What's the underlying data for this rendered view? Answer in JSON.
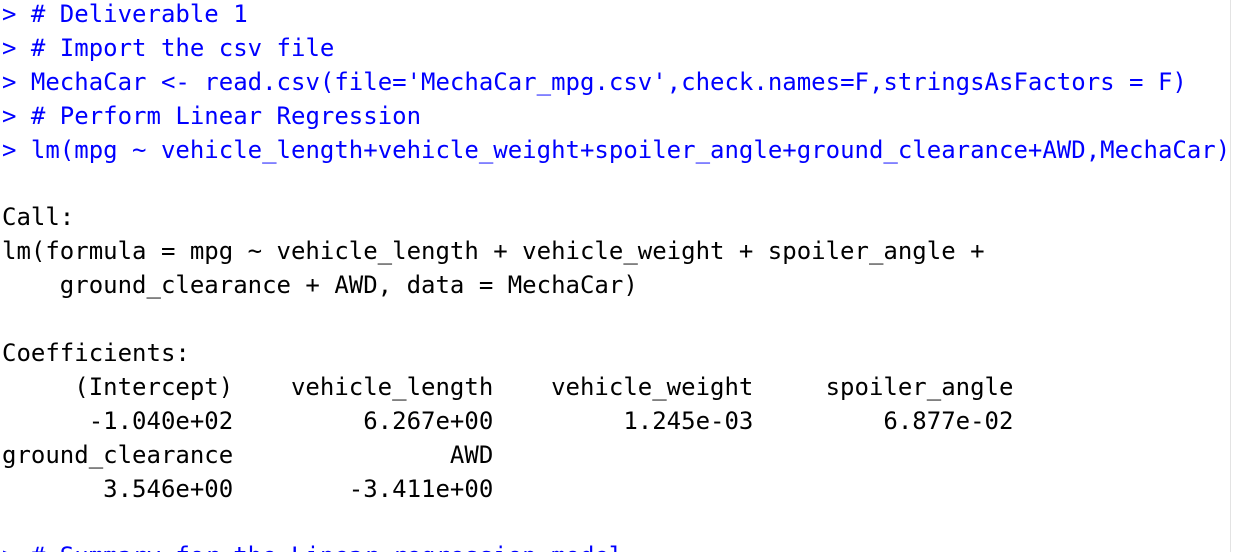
{
  "colors": {
    "input": "#0000ff",
    "output": "#000000",
    "background": "#ffffff"
  },
  "console": {
    "prompt": "> ",
    "commands": [
      "# Deliverable 1",
      "# Import the csv file",
      "MechaCar <- read.csv(file='MechaCar_mpg.csv',check.names=F,stringsAsFactors = F)",
      "# Perform Linear Regression",
      "lm(mpg ~ vehicle_length+vehicle_weight+spoiler_angle+ground_clearance+AWD,MechaCar)"
    ],
    "output": {
      "call_label": "Call:",
      "call_line_1": "lm(formula = mpg ~ vehicle_length + vehicle_weight + spoiler_angle + ",
      "call_line_2": "    ground_clearance + AWD, data = MechaCar)",
      "coefficients_label": "Coefficients:",
      "coef_header_1": "     (Intercept)    vehicle_length    vehicle_weight     spoiler_angle  ",
      "coef_values_1": "      -1.040e+02         6.267e+00         1.245e-03         6.877e-02  ",
      "coef_header_2": "ground_clearance               AWD  ",
      "coef_values_2": "       3.546e+00        -3.411e+00  "
    },
    "partial_next_command": "# Summary for the Linear regression model"
  }
}
